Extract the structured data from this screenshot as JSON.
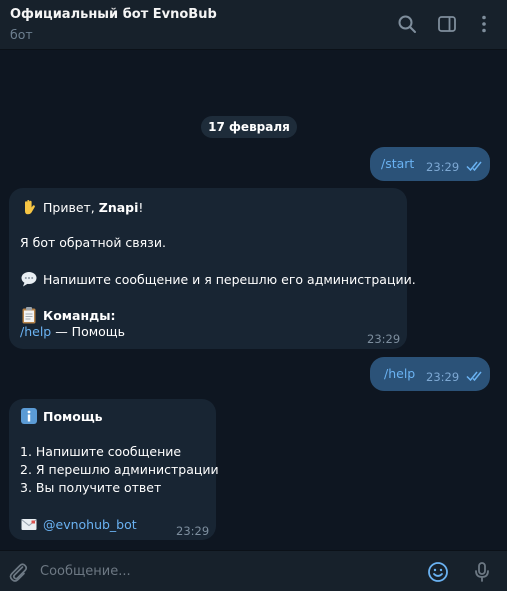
{
  "header": {
    "title": "Официальный бот EvnoBub",
    "subtitle": "бот",
    "icons": [
      "search-icon",
      "sidebar-toggle-icon",
      "more-vertical-icon"
    ]
  },
  "chat": {
    "date_label": "17 февраля",
    "messages": [
      {
        "direction": "out",
        "text": "/start",
        "time": "23:29",
        "status": "read"
      },
      {
        "direction": "in",
        "lines": [
          {
            "emoji": "waving-hand-icon",
            "prefix": "Привет, ",
            "bold": "Znapi",
            "suffix": "!"
          },
          {
            "text": "Я бот обратной связи."
          },
          {
            "emoji": "speech-balloon-icon",
            "text": "Напишите сообщение и я перешлю его администрации."
          },
          {
            "emoji": "clipboard-icon",
            "bold": "Команды:"
          },
          {
            "command": "/help",
            "text": " — Помощь"
          }
        ],
        "time": "23:29"
      },
      {
        "direction": "out",
        "text": "/help",
        "time": "23:29",
        "status": "read"
      },
      {
        "direction": "in",
        "lines": [
          {
            "emoji": "information-icon",
            "bold": "Помощь"
          },
          {
            "text": "1. Напишите сообщение"
          },
          {
            "text": "2. Я перешлю администрации"
          },
          {
            "text": "3. Вы получите ответ"
          },
          {
            "emoji": "envelope-icon",
            "link": "@evnohub_bot"
          }
        ],
        "time": "23:29"
      }
    ]
  },
  "composer": {
    "placeholder": "Сообщение...",
    "icons": [
      "attach-paperclip-icon",
      "emoji-smiley-icon",
      "microphone-icon"
    ]
  },
  "colors": {
    "background": "#0e1621",
    "header": "#17212b",
    "outgoing_bubble": "#2b5278",
    "incoming_bubble": "#182533",
    "link": "#6ab2f2",
    "muted": "#6d7f8f",
    "read_ticks": "#6ab2f2"
  }
}
